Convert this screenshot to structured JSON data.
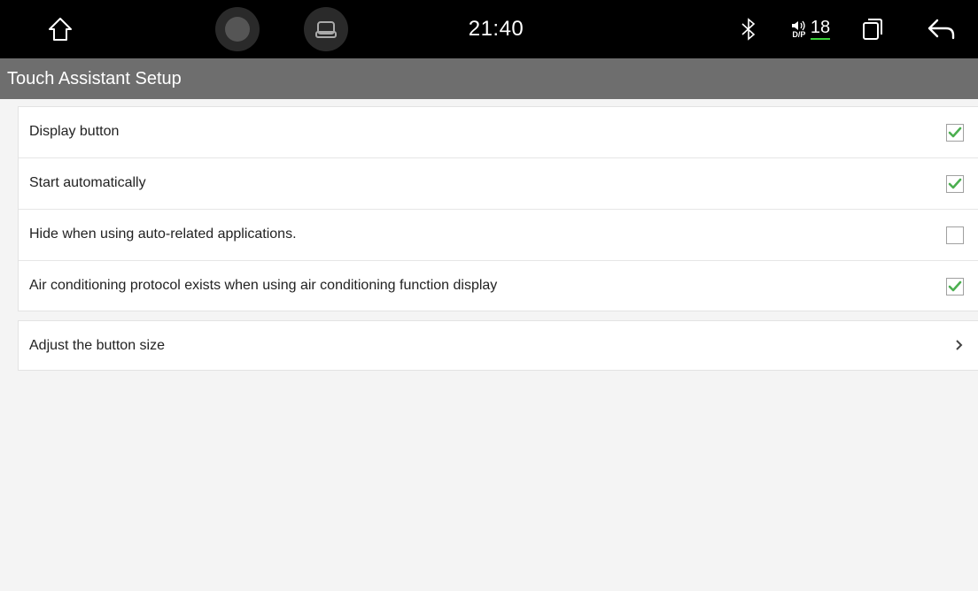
{
  "status_bar": {
    "time": "21:40",
    "volume_level": "18",
    "volume_sublabel": "D/P"
  },
  "header": {
    "title": "Touch Assistant Setup"
  },
  "settings": [
    {
      "label": "Display button",
      "checked": true
    },
    {
      "label": "Start automatically",
      "checked": true
    },
    {
      "label": "Hide when using auto-related applications.",
      "checked": false
    },
    {
      "label": "Air conditioning protocol exists when using air conditioning function display",
      "checked": true
    }
  ],
  "nav_item": {
    "label": "Adjust the button size"
  },
  "colors": {
    "check_green": "#4caf50",
    "volume_underline": "#3ad13a",
    "header_bg": "#6e6e6e"
  }
}
